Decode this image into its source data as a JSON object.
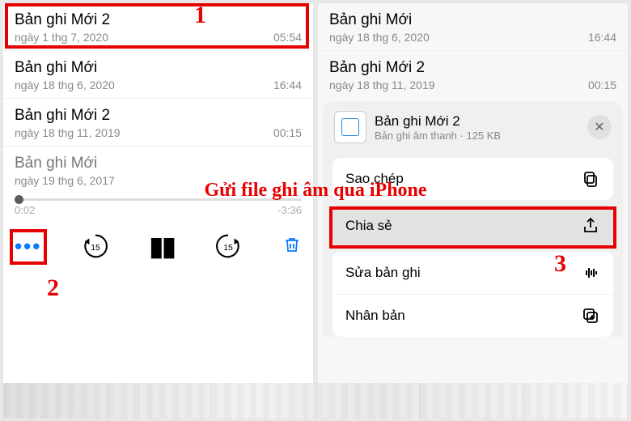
{
  "overlay_text": "Gửi file ghi âm qua iPhone",
  "annotations": {
    "n1": "1",
    "n2": "2",
    "n3": "3"
  },
  "left": {
    "items": [
      {
        "title": "Bản ghi Mới 2",
        "date": "ngày 1 thg 7, 2020",
        "dur": "05:54"
      },
      {
        "title": "Bản ghi Mới",
        "date": "ngày 18 thg 6, 2020",
        "dur": "16:44"
      },
      {
        "title": "Bản ghi Mới 2",
        "date": "ngày 18 thg 11, 2019",
        "dur": "00:15"
      },
      {
        "title": "Bản ghi Mới",
        "date": "ngày 19 thg 6, 2017",
        "dur": ""
      }
    ],
    "scrub": {
      "elapsed": "0:02",
      "remain": "-3:36"
    },
    "skip_secs": "15"
  },
  "right": {
    "items": [
      {
        "title": "Bản ghi Mới",
        "date": "ngày 18 thg 6, 2020",
        "dur": "16:44"
      },
      {
        "title": "Bản ghi Mới 2",
        "date": "ngày 18 thg 11, 2019",
        "dur": "00:15"
      }
    ],
    "sheet": {
      "title": "Bản ghi Mới 2",
      "meta": "Bản ghi âm thanh · 125 KB",
      "actions": {
        "copy": "Sao chép",
        "share": "Chia sẻ",
        "edit": "Sửa bản ghi",
        "dup": "Nhân bản"
      }
    }
  }
}
